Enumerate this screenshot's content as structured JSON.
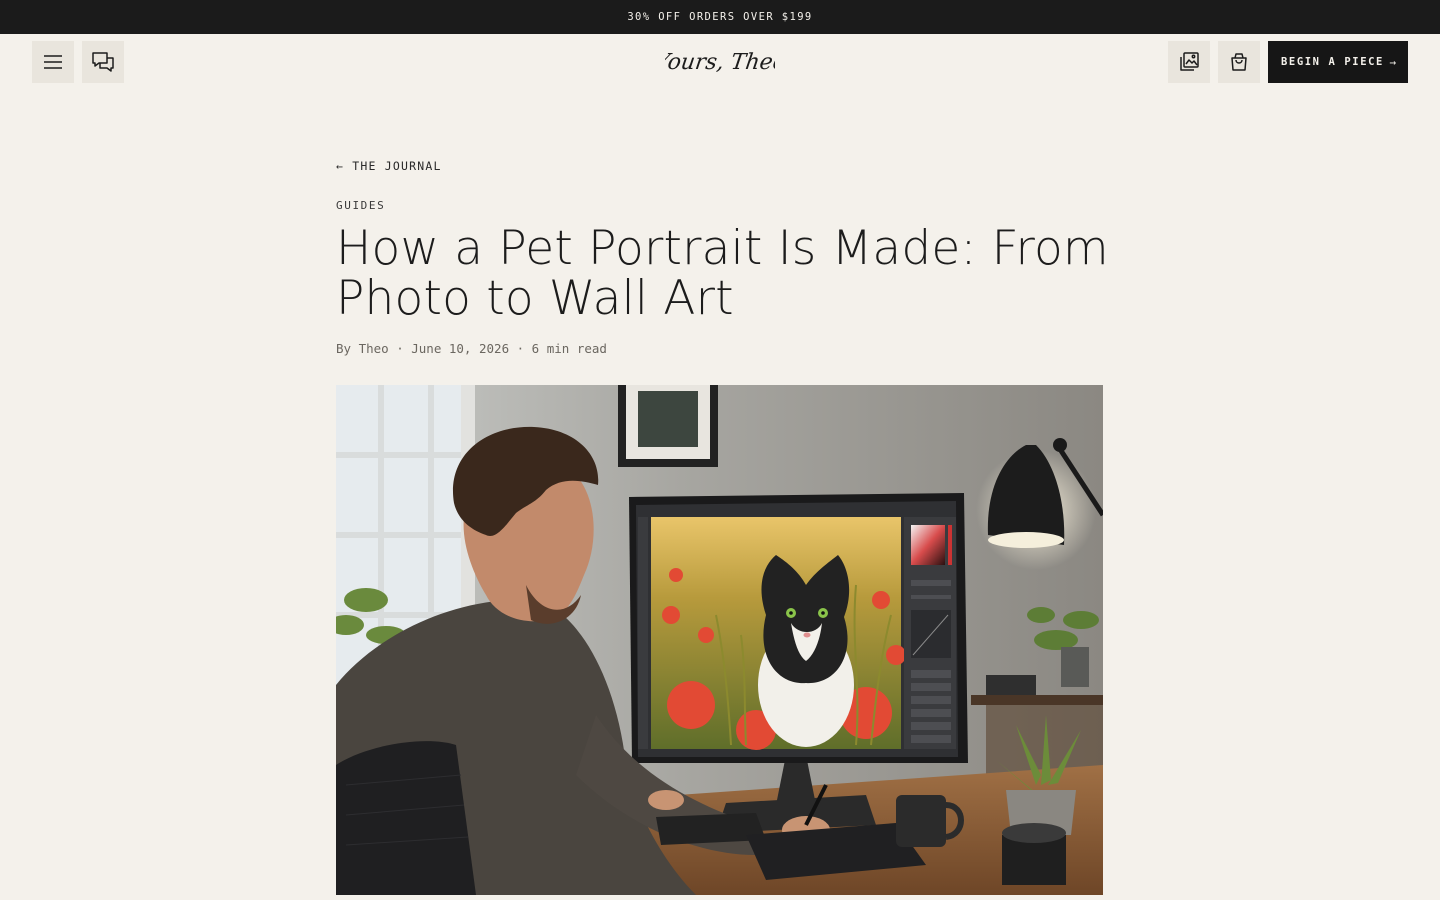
{
  "promo": {
    "text": "30% OFF ORDERS OVER $199"
  },
  "header": {
    "menu_icon": "menu-icon",
    "chat_icon": "chat-bubbles-icon",
    "logo_text": "Yours, Theo",
    "gallery_icon": "image-gallery-icon",
    "cart_icon": "shopping-bag-icon",
    "cta_label": "BEGIN A PIECE",
    "cta_arrow": "→"
  },
  "article": {
    "back_label": "← THE JOURNAL",
    "category": "GUIDES",
    "title": "How a Pet Portrait Is Made: From Photo to Wall Art",
    "meta": "By Theo · June 10, 2026 · 6 min read",
    "hero_image": "artist-editing-cat-portrait-on-monitor"
  },
  "colors": {
    "page_bg": "#f4f1eb",
    "promo_bg": "#1b1b1b",
    "icon_button_bg": "#e9e5dd",
    "cta_bg": "#161616",
    "text": "#1c1c1c",
    "meta_text": "#6b6760"
  }
}
